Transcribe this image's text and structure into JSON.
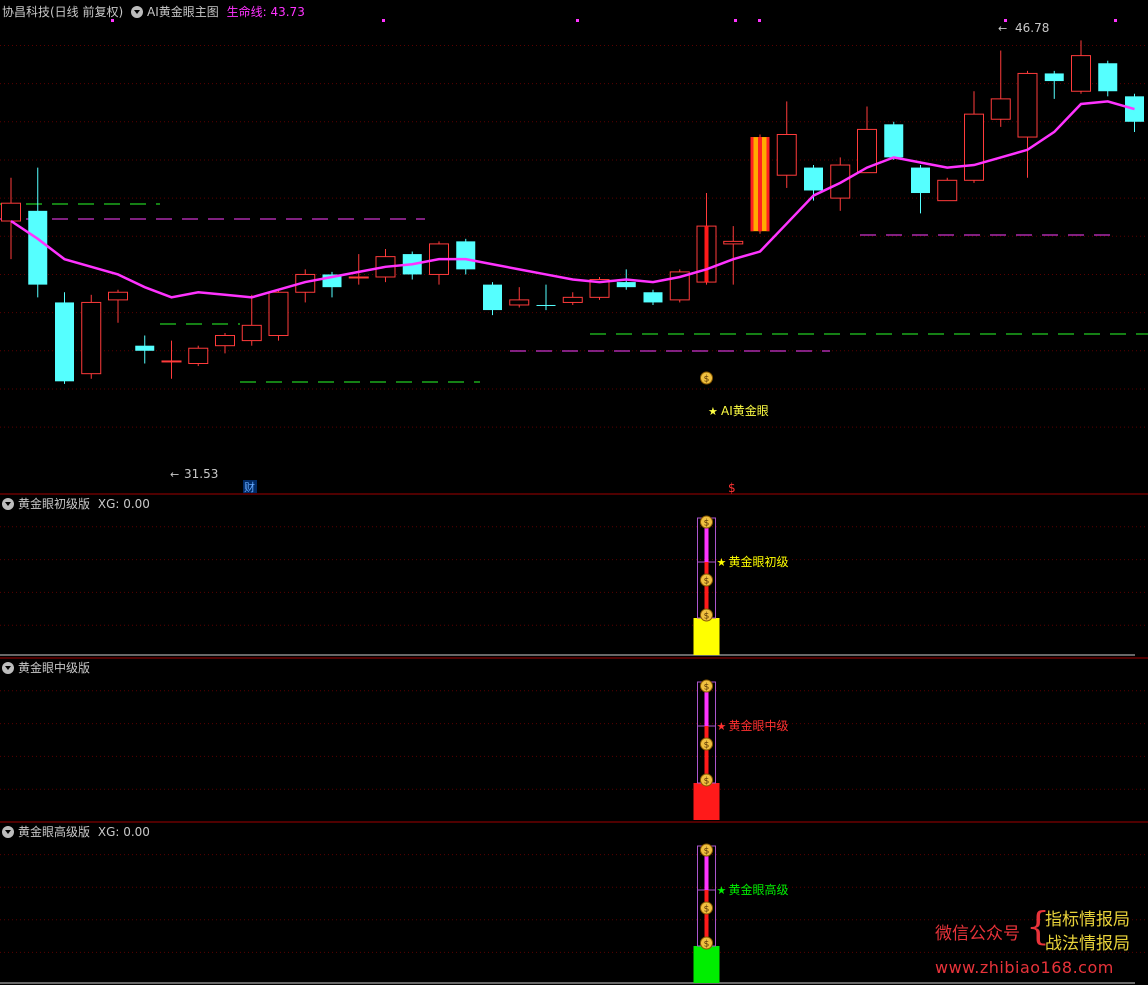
{
  "main_panel": {
    "stock": "协昌科技(日线 前复权)",
    "indicator": "AI黄金眼主图",
    "life_line_label": "生命线:",
    "life_line_value": "43.73",
    "high_label": "46.78",
    "low_label": "31.53",
    "signal_label": "AI黄金眼",
    "cai_marker": "财",
    "dollar_marker": "$"
  },
  "panels": [
    {
      "title": "黄金眼初级版",
      "xg": "XG: 0.00",
      "signal": "黄金眼初级",
      "color": "#ffff00"
    },
    {
      "title": "黄金眼中级版",
      "xg": "",
      "signal": "黄金眼中级",
      "color": "#ff1a1a"
    },
    {
      "title": "黄金眼高级版",
      "xg": "XG: 0.00",
      "signal": "黄金眼高级",
      "color": "#00ee00"
    }
  ],
  "watermark": {
    "wechat": "微信公众号",
    "line1": "指标情报局",
    "line2": "战法情报局",
    "url": "www.zhibiao168.com"
  },
  "chart_data": {
    "type": "candlestick",
    "price_range": [
      30.0,
      48.0
    ],
    "candles": [
      {
        "o": 40.8,
        "c": 40.1,
        "h": 41.8,
        "l": 38.6,
        "up": true
      },
      {
        "o": 40.5,
        "c": 37.6,
        "h": 42.2,
        "l": 37.1,
        "up": false
      },
      {
        "o": 36.9,
        "c": 33.8,
        "h": 37.3,
        "l": 33.7,
        "up": false
      },
      {
        "o": 34.1,
        "c": 36.9,
        "h": 37.2,
        "l": 33.9,
        "up": true
      },
      {
        "o": 37.0,
        "c": 37.3,
        "h": 37.4,
        "l": 36.1,
        "up": true
      },
      {
        "o": 35.2,
        "c": 35.0,
        "h": 35.6,
        "l": 34.5,
        "up": false
      },
      {
        "o": 34.6,
        "c": 34.6,
        "h": 35.4,
        "l": 33.9,
        "up": true
      },
      {
        "o": 34.5,
        "c": 35.1,
        "h": 35.2,
        "l": 34.4,
        "up": true
      },
      {
        "o": 35.2,
        "c": 35.6,
        "h": 35.7,
        "l": 34.9,
        "up": true
      },
      {
        "o": 35.4,
        "c": 36.0,
        "h": 37.2,
        "l": 35.2,
        "up": true
      },
      {
        "o": 35.6,
        "c": 37.3,
        "h": 37.4,
        "l": 35.4,
        "up": true
      },
      {
        "o": 37.3,
        "c": 38.0,
        "h": 38.2,
        "l": 36.9,
        "up": true
      },
      {
        "o": 38.0,
        "c": 37.5,
        "h": 38.1,
        "l": 37.1,
        "up": false
      },
      {
        "o": 37.9,
        "c": 37.9,
        "h": 38.8,
        "l": 37.6,
        "up": true
      },
      {
        "o": 37.9,
        "c": 38.7,
        "h": 39.0,
        "l": 37.7,
        "up": true
      },
      {
        "o": 38.8,
        "c": 38.0,
        "h": 38.9,
        "l": 37.8,
        "up": false
      },
      {
        "o": 38.0,
        "c": 39.2,
        "h": 39.3,
        "l": 37.6,
        "up": true
      },
      {
        "o": 39.3,
        "c": 38.2,
        "h": 39.4,
        "l": 38.0,
        "up": false
      },
      {
        "o": 37.6,
        "c": 36.6,
        "h": 37.7,
        "l": 36.4,
        "up": false
      },
      {
        "o": 36.8,
        "c": 37.0,
        "h": 37.5,
        "l": 36.7,
        "up": true
      },
      {
        "o": 36.8,
        "c": 36.8,
        "h": 37.6,
        "l": 36.6,
        "up": false
      },
      {
        "o": 36.9,
        "c": 37.1,
        "h": 37.3,
        "l": 36.8,
        "up": true
      },
      {
        "o": 37.1,
        "c": 37.8,
        "h": 37.9,
        "l": 37.0,
        "up": true
      },
      {
        "o": 37.7,
        "c": 37.5,
        "h": 38.2,
        "l": 37.4,
        "up": false
      },
      {
        "o": 37.3,
        "c": 36.9,
        "h": 37.4,
        "l": 36.8,
        "up": false
      },
      {
        "o": 37.0,
        "c": 38.1,
        "h": 38.2,
        "l": 36.9,
        "up": true
      },
      {
        "o": 37.7,
        "c": 39.9,
        "h": 41.2,
        "l": 37.6,
        "up": true
      },
      {
        "o": 39.2,
        "c": 39.3,
        "h": 39.9,
        "l": 37.6,
        "up": true
      },
      {
        "o": 39.7,
        "c": 43.4,
        "h": 43.5,
        "l": 39.6,
        "up": true
      },
      {
        "o": 41.9,
        "c": 43.5,
        "h": 44.8,
        "l": 41.4,
        "up": true
      },
      {
        "o": 42.2,
        "c": 41.3,
        "h": 42.3,
        "l": 40.9,
        "up": false
      },
      {
        "o": 41.0,
        "c": 42.3,
        "h": 42.6,
        "l": 40.5,
        "up": true
      },
      {
        "o": 42.0,
        "c": 43.7,
        "h": 44.6,
        "l": 42.0,
        "up": true
      },
      {
        "o": 43.9,
        "c": 42.6,
        "h": 44.0,
        "l": 42.5,
        "up": false
      },
      {
        "o": 42.2,
        "c": 41.2,
        "h": 42.3,
        "l": 40.4,
        "up": false
      },
      {
        "o": 40.9,
        "c": 41.7,
        "h": 41.8,
        "l": 40.9,
        "up": true
      },
      {
        "o": 41.7,
        "c": 44.3,
        "h": 45.2,
        "l": 41.6,
        "up": true
      },
      {
        "o": 44.1,
        "c": 44.9,
        "h": 46.8,
        "l": 43.8,
        "up": true
      },
      {
        "o": 43.4,
        "c": 45.9,
        "h": 46.0,
        "l": 41.8,
        "up": true
      },
      {
        "o": 45.9,
        "c": 45.6,
        "h": 46.0,
        "l": 44.9,
        "up": false
      },
      {
        "o": 45.2,
        "c": 46.6,
        "h": 47.2,
        "l": 45.1,
        "up": true
      },
      {
        "o": 46.3,
        "c": 45.2,
        "h": 46.4,
        "l": 45.0,
        "up": false
      },
      {
        "o": 45.0,
        "c": 44.0,
        "h": 45.1,
        "l": 43.6,
        "up": false
      }
    ],
    "life_line": [
      40.1,
      39.4,
      38.6,
      38.3,
      38.0,
      37.5,
      37.1,
      37.3,
      37.2,
      37.1,
      37.4,
      37.7,
      37.9,
      38.1,
      38.3,
      38.4,
      38.6,
      38.6,
      38.4,
      38.2,
      38.0,
      37.8,
      37.7,
      37.8,
      37.7,
      37.9,
      38.2,
      38.6,
      38.9,
      40.0,
      41.1,
      41.6,
      42.2,
      42.6,
      42.4,
      42.2,
      42.3,
      42.6,
      42.9,
      43.6,
      44.7,
      44.8,
      44.5
    ]
  }
}
